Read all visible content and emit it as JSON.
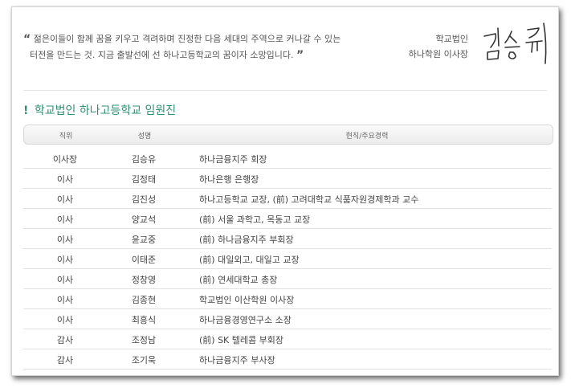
{
  "quote": {
    "line1": "젊은이들이 함께 꿈을 키우고 격려하며 진정한 다음 세대의 주역으로 커나갈 수 있는",
    "line2": "터전을 만드는 것. 지금 출발선에 선 하나고등학교의 꿈이자 소망입니다.",
    "open_mark": "“",
    "close_mark": "”"
  },
  "chairman": {
    "org": "학교법인",
    "title": "하나학원 이사장",
    "signature": "김승유"
  },
  "section": {
    "marker": "!",
    "title": "학교법인 하나고등학교 임원진"
  },
  "table": {
    "headers": [
      "직위",
      "성명",
      "현직/주요경력"
    ],
    "rows": [
      [
        "이사장",
        "김승유",
        "하나금융지주 회장"
      ],
      [
        "이사",
        "김정태",
        "하나은행 은행장"
      ],
      [
        "이사",
        "김진성",
        "하나고등학교 교장, (前) 고려대학교 식품자원경제학과 교수"
      ],
      [
        "이사",
        "양교석",
        "(前) 서울 과학고, 목동고 교장"
      ],
      [
        "이사",
        "윤교중",
        "(前) 하나금융지주 부회장"
      ],
      [
        "이사",
        "이태준",
        "(前) 대일외고, 대일고 교장"
      ],
      [
        "이사",
        "정창영",
        "(前) 연세대학교 총장"
      ],
      [
        "이사",
        "김종현",
        "학교법인 이산학원 이사장"
      ],
      [
        "이사",
        "최흥식",
        "하나금융경영연구소 소장"
      ],
      [
        "감사",
        "조정남",
        "(前) SK 텔레콤 부회장"
      ],
      [
        "감사",
        "조기욱",
        "하나금융지주 부사장"
      ]
    ]
  },
  "colors": {
    "accent": "#2f8f6f",
    "text": "#444444"
  }
}
